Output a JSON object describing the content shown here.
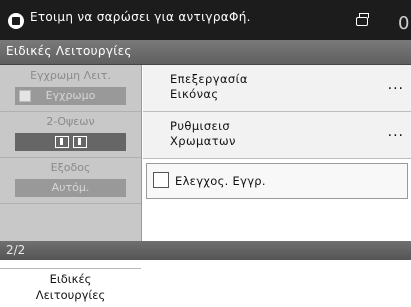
{
  "status": {
    "message": "Ετοιμη να σαρώσει για αντιγραΦή.",
    "copy_count": "0"
  },
  "title": "Ειδικές Λειτουργίες",
  "left": {
    "groups": [
      {
        "label": "Εγχρωμη Λειτ.",
        "value": "Εγχρωμο"
      },
      {
        "label": "2-Οψεων",
        "value": ""
      },
      {
        "label": "Εξοδος",
        "value": "Αυτόμ."
      }
    ],
    "active_line1": "Ειδικές",
    "active_line2": "Λειτουργίες"
  },
  "menu": [
    {
      "line1": "Επεξεργασία",
      "line2": "Εικόνας",
      "more": "..."
    },
    {
      "line1": "Ρυθμισεισ",
      "line2": "Χρωματων",
      "more": "..."
    }
  ],
  "check": {
    "label": "Ελεγχος. Εγγρ."
  },
  "footer": {
    "page": "2/2"
  }
}
